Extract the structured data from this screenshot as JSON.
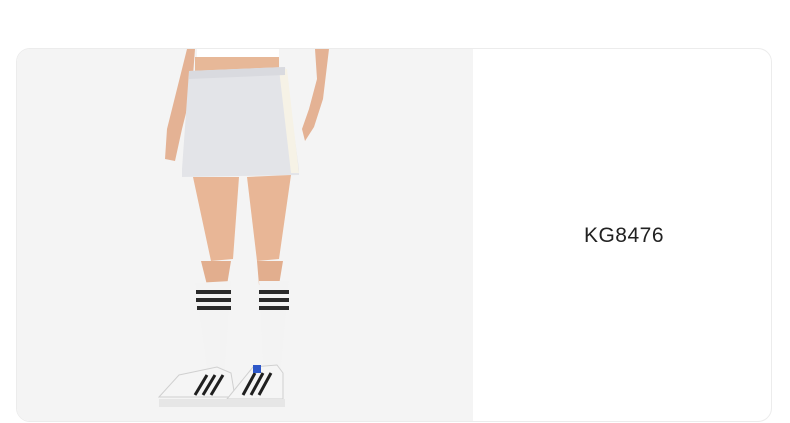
{
  "product": {
    "sku": "KG8476",
    "image": {
      "icon": "product-photo-skirt-socks-sneakers",
      "background_color": "#f4f4f4"
    }
  },
  "colors": {
    "card_background": "#ffffff",
    "card_border": "#ececec",
    "text": "#222222"
  }
}
